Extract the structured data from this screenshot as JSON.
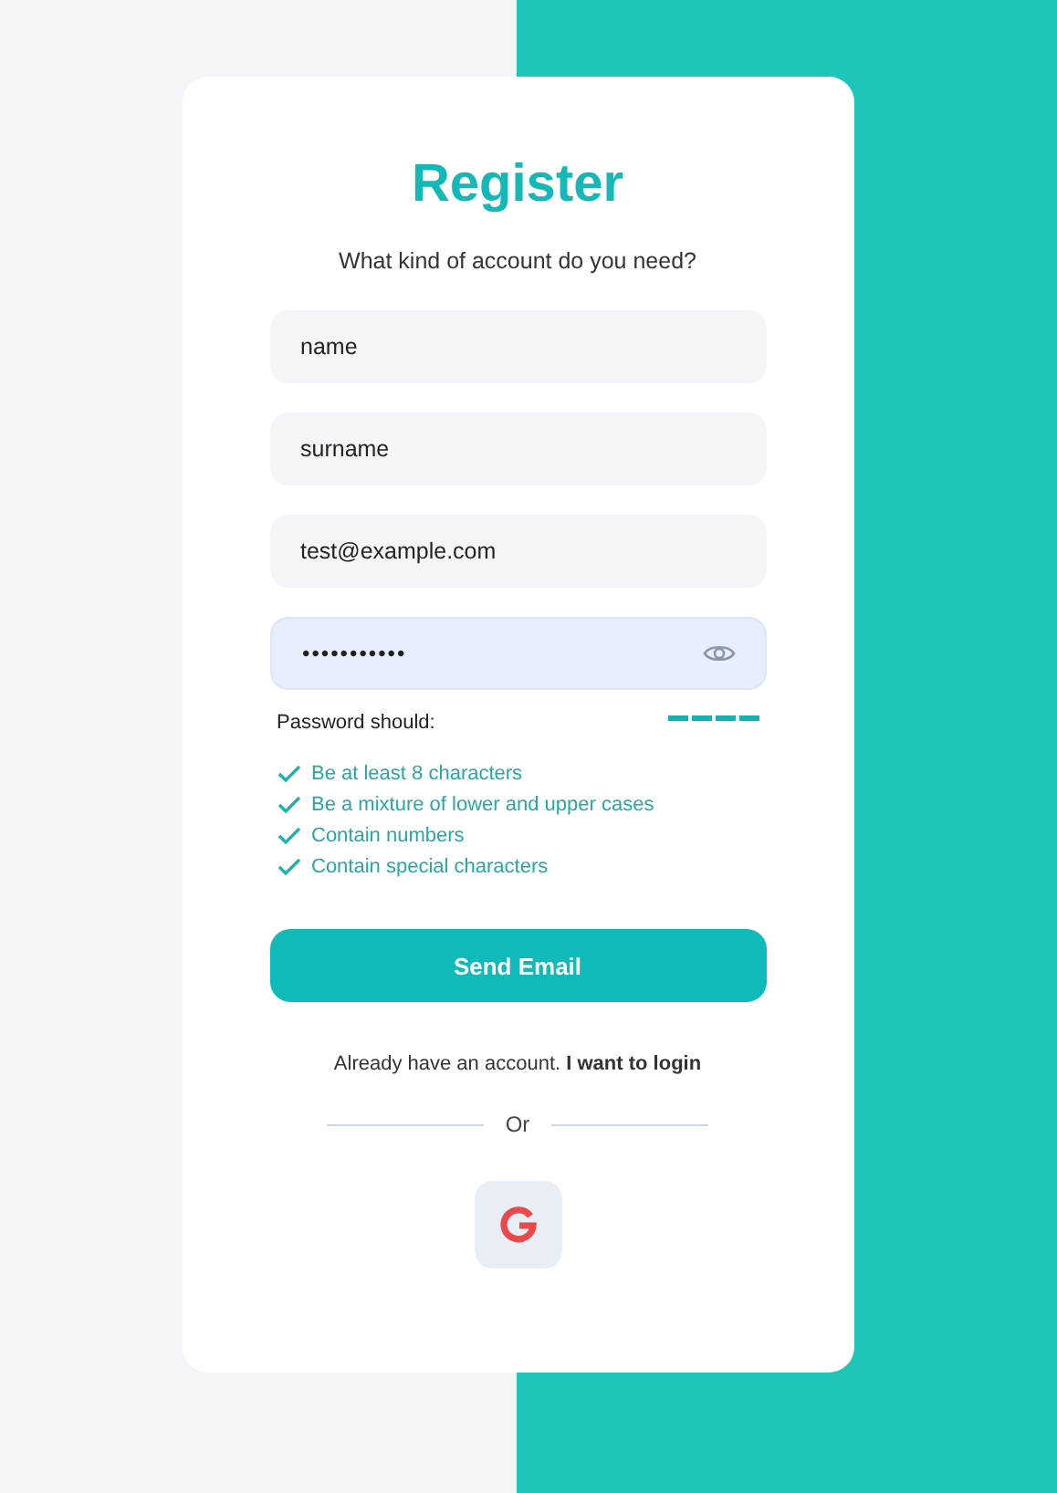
{
  "title": "Register",
  "subtitle": "What kind of account do you need?",
  "fields": [
    {
      "kind": "text",
      "value": "name",
      "focused": false
    },
    {
      "kind": "text",
      "value": "surname",
      "focused": false
    },
    {
      "kind": "text",
      "value": "test@example.com",
      "focused": false
    },
    {
      "kind": "password",
      "value": "•••••••••••",
      "focused": true
    }
  ],
  "password_rules": {
    "label": "Password should:",
    "items": [
      {
        "text": "Be at least 8 characters",
        "met": true
      },
      {
        "text": "Be a mixture of lower and upper cases",
        "met": true
      },
      {
        "text": "Contain numbers",
        "met": true
      },
      {
        "text": "Contain special characters",
        "met": true
      }
    ]
  },
  "submit": "Send Email",
  "login": {
    "text": "Already have an account.",
    "link": "I want to login"
  },
  "divider": "Or",
  "social": [
    {
      "kind": "google"
    }
  ]
}
